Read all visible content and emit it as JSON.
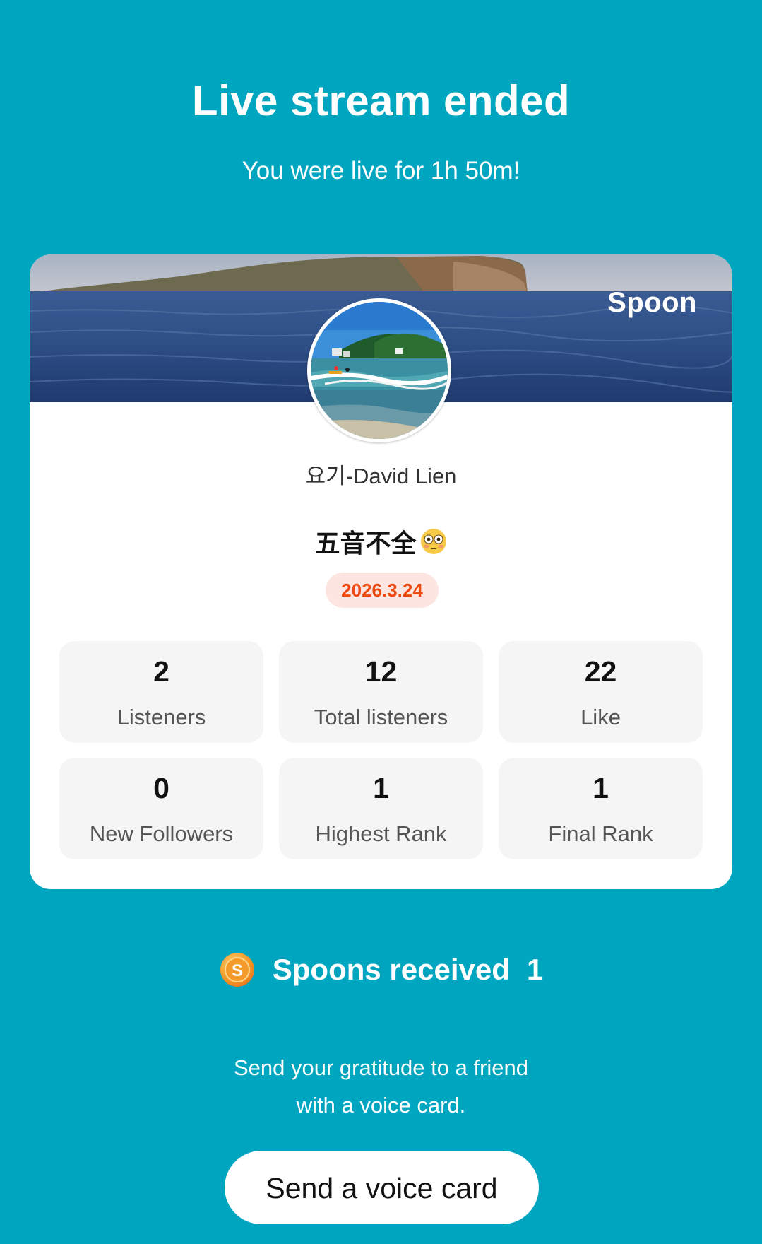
{
  "header": {
    "title": "Live stream ended",
    "subtitle": "You were live for 1h 50m!"
  },
  "card": {
    "brand": "Spoon",
    "nickname": "요기-David Lien",
    "stream_title": "五音不全",
    "title_emoji": "flushed-face-emoji",
    "date": "2026.3.24",
    "stats": [
      {
        "value": "2",
        "label": "Listeners"
      },
      {
        "value": "12",
        "label": "Total listeners"
      },
      {
        "value": "22",
        "label": "Like"
      },
      {
        "value": "0",
        "label": "New Followers"
      },
      {
        "value": "1",
        "label": "Highest Rank"
      },
      {
        "value": "1",
        "label": "Final Rank"
      }
    ]
  },
  "spoons": {
    "label": "Spoons received",
    "count": "1",
    "icon": "spoon-coin-icon"
  },
  "gratitude": {
    "line1": "Send your gratitude to a friend",
    "line2": "with a voice card."
  },
  "voice_button": {
    "label": "Send a voice card"
  },
  "colors": {
    "background": "#00a6c0",
    "date_badge_bg": "#fde6e1",
    "date_badge_text": "#f04a14",
    "stat_tile_bg": "#f5f5f5",
    "coin_orange": "#f6a02c"
  }
}
